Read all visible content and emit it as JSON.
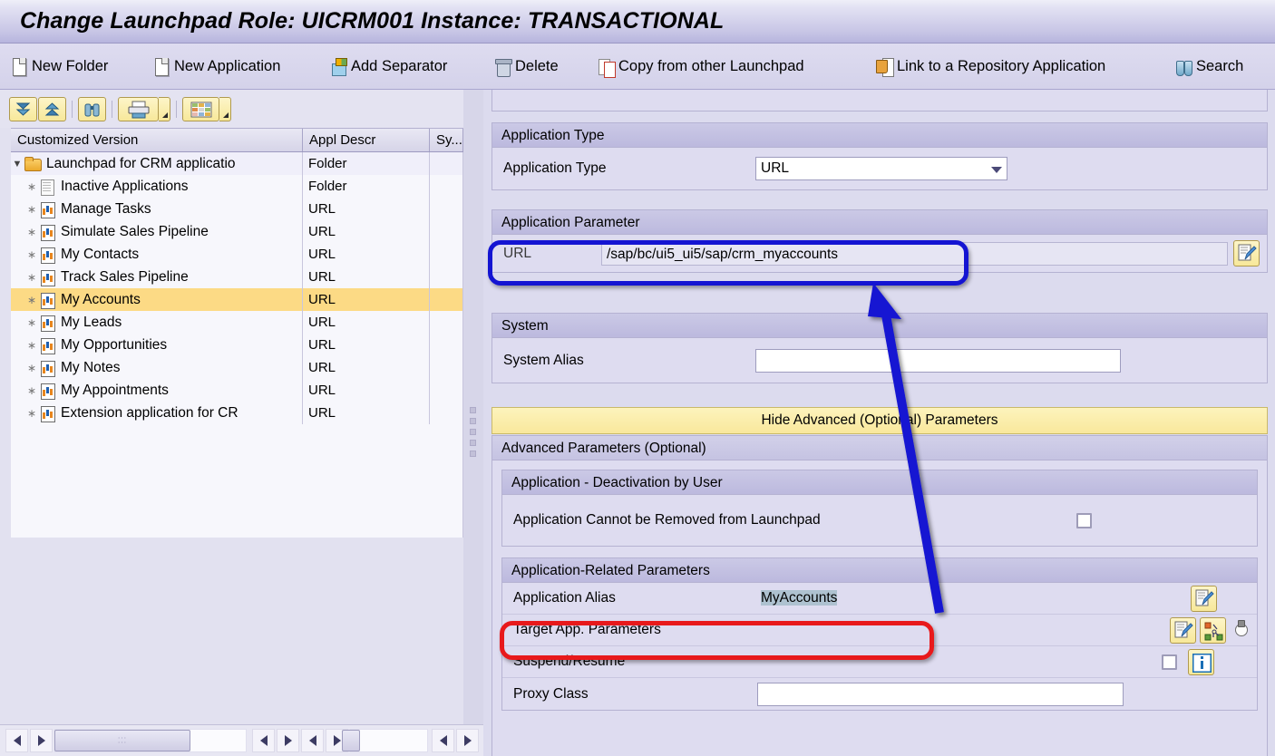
{
  "window": {
    "title": "Change Launchpad Role: UICRM001 Instance: TRANSACTIONAL"
  },
  "toolbar": {
    "buttons": [
      {
        "label": "New Folder",
        "icon": "new-folder-icon"
      },
      {
        "label": "New Application",
        "icon": "new-application-icon"
      },
      {
        "label": "Add Separator",
        "icon": "add-separator-icon"
      },
      {
        "label": "Delete",
        "icon": "delete-icon"
      },
      {
        "label": "Copy from other Launchpad",
        "icon": "copy-icon"
      },
      {
        "label": "Link to a Repository Application",
        "icon": "link-repository-icon"
      },
      {
        "label": "Search",
        "icon": "binoculars-icon"
      }
    ]
  },
  "tree_toolbar": {
    "buttons": [
      {
        "name": "expand-all-icon"
      },
      {
        "name": "collapse-all-icon"
      },
      {
        "name": "find-icon"
      },
      {
        "name": "print-icon"
      },
      {
        "name": "layout-icon"
      }
    ]
  },
  "tree": {
    "columns": [
      "Customized Version",
      "Appl Descr",
      "Sy..."
    ],
    "rows": [
      {
        "label": "Launchpad for CRM applicatio",
        "descr": "Folder",
        "icon": "folder-icon",
        "depth": 0,
        "expander": "expanded",
        "selected": false
      },
      {
        "label": "Inactive Applications",
        "descr": "Folder",
        "icon": "document-icon",
        "depth": 1,
        "expander": "leaf",
        "selected": false
      },
      {
        "label": "Manage Tasks",
        "descr": "URL",
        "icon": "application-icon",
        "depth": 1,
        "expander": "leaf",
        "selected": false
      },
      {
        "label": "Simulate Sales Pipeline",
        "descr": "URL",
        "icon": "application-icon",
        "depth": 1,
        "expander": "leaf",
        "selected": false
      },
      {
        "label": "My Contacts",
        "descr": "URL",
        "icon": "application-icon",
        "depth": 1,
        "expander": "leaf",
        "selected": false
      },
      {
        "label": "Track Sales Pipeline",
        "descr": "URL",
        "icon": "application-icon",
        "depth": 1,
        "expander": "leaf",
        "selected": false
      },
      {
        "label": "My Accounts",
        "descr": "URL",
        "icon": "application-icon",
        "depth": 1,
        "expander": "leaf",
        "selected": true
      },
      {
        "label": "My Leads",
        "descr": "URL",
        "icon": "application-icon",
        "depth": 1,
        "expander": "leaf",
        "selected": false
      },
      {
        "label": "My Opportunities",
        "descr": "URL",
        "icon": "application-icon",
        "depth": 1,
        "expander": "leaf",
        "selected": false
      },
      {
        "label": "My Notes",
        "descr": "URL",
        "icon": "application-icon",
        "depth": 1,
        "expander": "leaf",
        "selected": false
      },
      {
        "label": "My Appointments",
        "descr": "URL",
        "icon": "application-icon",
        "depth": 1,
        "expander": "leaf",
        "selected": false
      },
      {
        "label": "Extension application for CR",
        "descr": "URL",
        "icon": "application-icon",
        "depth": 1,
        "expander": "leaf",
        "selected": false
      }
    ]
  },
  "detail": {
    "application_type": {
      "group_title": "Application Type",
      "field_label": "Application Type",
      "value": "URL"
    },
    "application_parameter": {
      "group_title": "Application Parameter",
      "url_label": "URL",
      "url_value": "/sap/bc/ui5_ui5/sap/crm_myaccounts"
    },
    "system": {
      "group_title": "System",
      "alias_label": "System Alias",
      "alias_value": ""
    },
    "hide_advanced_label": "Hide Advanced (Optional) Parameters",
    "advanced": {
      "group_title": "Advanced Parameters (Optional)",
      "deactivation": {
        "group_title": "Application - Deactivation by User",
        "cannot_remove_label": "Application Cannot be Removed from Launchpad",
        "cannot_remove_checked": false
      },
      "related": {
        "group_title": "Application-Related Parameters",
        "rows": [
          {
            "label": "Application Alias",
            "value": "MyAccounts",
            "selected_text": true
          },
          {
            "label": "Target App. Parameters",
            "value": "",
            "selected_text": false
          },
          {
            "label": "Suspend/Resume",
            "value": "",
            "selected_text": false
          },
          {
            "label": "Proxy Class",
            "value": "",
            "selected_text": false
          }
        ]
      }
    }
  },
  "annotations": {
    "url_highlight_color": "#1414d2",
    "alias_highlight_color": "#e8191b",
    "arrow_color": "#1414d2"
  },
  "scrollbars": {
    "left_arrow": "◀",
    "right_arrow": "▶"
  }
}
